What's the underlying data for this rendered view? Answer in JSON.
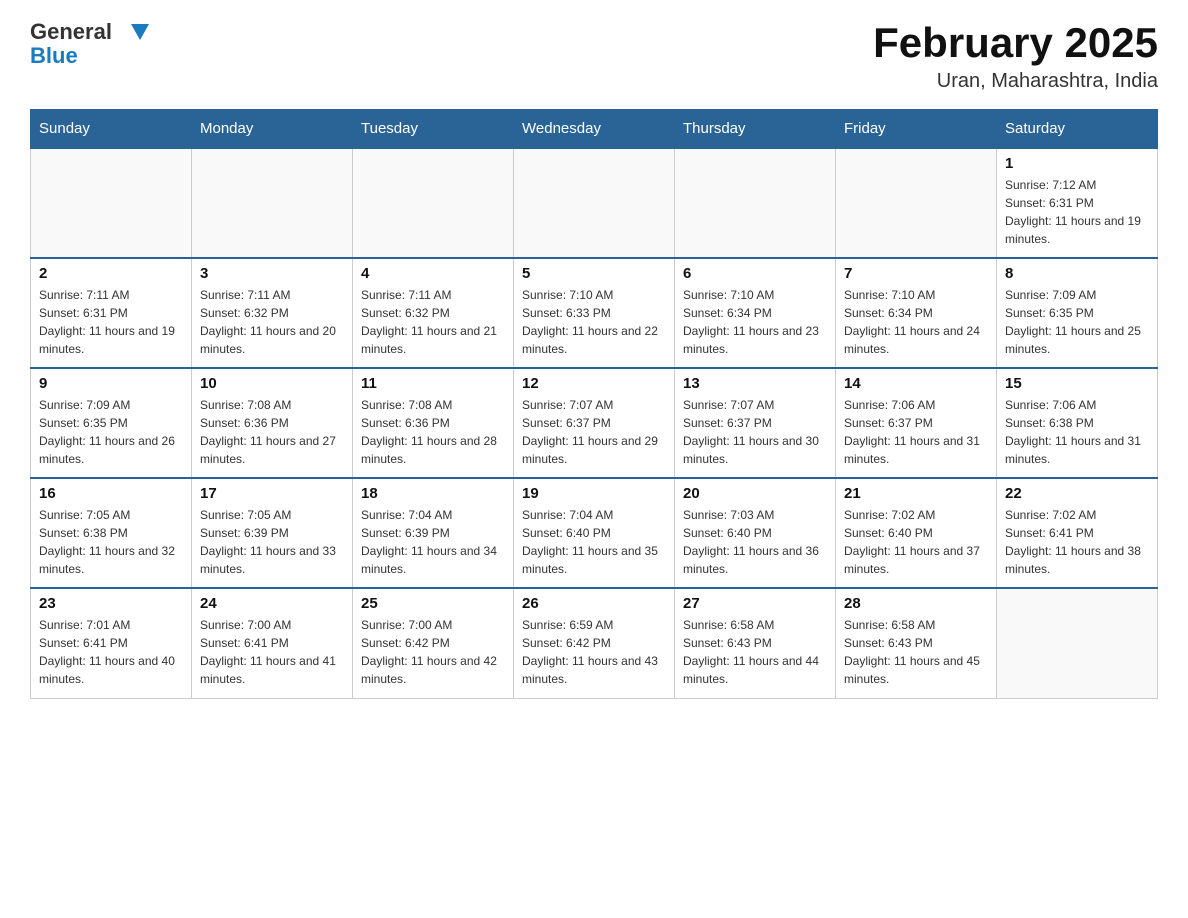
{
  "header": {
    "logo_general": "General",
    "logo_blue": "Blue",
    "month_title": "February 2025",
    "location": "Uran, Maharashtra, India"
  },
  "days_of_week": [
    "Sunday",
    "Monday",
    "Tuesday",
    "Wednesday",
    "Thursday",
    "Friday",
    "Saturday"
  ],
  "weeks": [
    [
      {
        "day": "",
        "info": ""
      },
      {
        "day": "",
        "info": ""
      },
      {
        "day": "",
        "info": ""
      },
      {
        "day": "",
        "info": ""
      },
      {
        "day": "",
        "info": ""
      },
      {
        "day": "",
        "info": ""
      },
      {
        "day": "1",
        "info": "Sunrise: 7:12 AM\nSunset: 6:31 PM\nDaylight: 11 hours and 19 minutes."
      }
    ],
    [
      {
        "day": "2",
        "info": "Sunrise: 7:11 AM\nSunset: 6:31 PM\nDaylight: 11 hours and 19 minutes."
      },
      {
        "day": "3",
        "info": "Sunrise: 7:11 AM\nSunset: 6:32 PM\nDaylight: 11 hours and 20 minutes."
      },
      {
        "day": "4",
        "info": "Sunrise: 7:11 AM\nSunset: 6:32 PM\nDaylight: 11 hours and 21 minutes."
      },
      {
        "day": "5",
        "info": "Sunrise: 7:10 AM\nSunset: 6:33 PM\nDaylight: 11 hours and 22 minutes."
      },
      {
        "day": "6",
        "info": "Sunrise: 7:10 AM\nSunset: 6:34 PM\nDaylight: 11 hours and 23 minutes."
      },
      {
        "day": "7",
        "info": "Sunrise: 7:10 AM\nSunset: 6:34 PM\nDaylight: 11 hours and 24 minutes."
      },
      {
        "day": "8",
        "info": "Sunrise: 7:09 AM\nSunset: 6:35 PM\nDaylight: 11 hours and 25 minutes."
      }
    ],
    [
      {
        "day": "9",
        "info": "Sunrise: 7:09 AM\nSunset: 6:35 PM\nDaylight: 11 hours and 26 minutes."
      },
      {
        "day": "10",
        "info": "Sunrise: 7:08 AM\nSunset: 6:36 PM\nDaylight: 11 hours and 27 minutes."
      },
      {
        "day": "11",
        "info": "Sunrise: 7:08 AM\nSunset: 6:36 PM\nDaylight: 11 hours and 28 minutes."
      },
      {
        "day": "12",
        "info": "Sunrise: 7:07 AM\nSunset: 6:37 PM\nDaylight: 11 hours and 29 minutes."
      },
      {
        "day": "13",
        "info": "Sunrise: 7:07 AM\nSunset: 6:37 PM\nDaylight: 11 hours and 30 minutes."
      },
      {
        "day": "14",
        "info": "Sunrise: 7:06 AM\nSunset: 6:37 PM\nDaylight: 11 hours and 31 minutes."
      },
      {
        "day": "15",
        "info": "Sunrise: 7:06 AM\nSunset: 6:38 PM\nDaylight: 11 hours and 31 minutes."
      }
    ],
    [
      {
        "day": "16",
        "info": "Sunrise: 7:05 AM\nSunset: 6:38 PM\nDaylight: 11 hours and 32 minutes."
      },
      {
        "day": "17",
        "info": "Sunrise: 7:05 AM\nSunset: 6:39 PM\nDaylight: 11 hours and 33 minutes."
      },
      {
        "day": "18",
        "info": "Sunrise: 7:04 AM\nSunset: 6:39 PM\nDaylight: 11 hours and 34 minutes."
      },
      {
        "day": "19",
        "info": "Sunrise: 7:04 AM\nSunset: 6:40 PM\nDaylight: 11 hours and 35 minutes."
      },
      {
        "day": "20",
        "info": "Sunrise: 7:03 AM\nSunset: 6:40 PM\nDaylight: 11 hours and 36 minutes."
      },
      {
        "day": "21",
        "info": "Sunrise: 7:02 AM\nSunset: 6:40 PM\nDaylight: 11 hours and 37 minutes."
      },
      {
        "day": "22",
        "info": "Sunrise: 7:02 AM\nSunset: 6:41 PM\nDaylight: 11 hours and 38 minutes."
      }
    ],
    [
      {
        "day": "23",
        "info": "Sunrise: 7:01 AM\nSunset: 6:41 PM\nDaylight: 11 hours and 40 minutes."
      },
      {
        "day": "24",
        "info": "Sunrise: 7:00 AM\nSunset: 6:41 PM\nDaylight: 11 hours and 41 minutes."
      },
      {
        "day": "25",
        "info": "Sunrise: 7:00 AM\nSunset: 6:42 PM\nDaylight: 11 hours and 42 minutes."
      },
      {
        "day": "26",
        "info": "Sunrise: 6:59 AM\nSunset: 6:42 PM\nDaylight: 11 hours and 43 minutes."
      },
      {
        "day": "27",
        "info": "Sunrise: 6:58 AM\nSunset: 6:43 PM\nDaylight: 11 hours and 44 minutes."
      },
      {
        "day": "28",
        "info": "Sunrise: 6:58 AM\nSunset: 6:43 PM\nDaylight: 11 hours and 45 minutes."
      },
      {
        "day": "",
        "info": ""
      }
    ]
  ]
}
